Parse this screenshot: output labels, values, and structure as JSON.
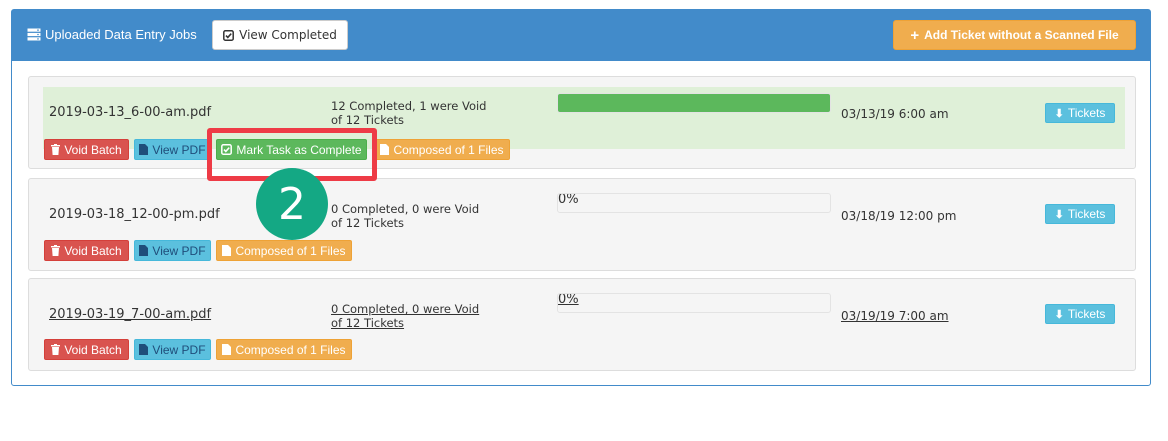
{
  "header": {
    "title": "Uploaded Data Entry Jobs",
    "view_completed_label": "View Completed",
    "add_ticket_label": "Add Ticket without a Scanned File"
  },
  "jobs": [
    {
      "filename": "2019-03-13_6-00-am.pdf",
      "status_line1": "12 Completed, 1 were Void",
      "status_line2": "of 12 Tickets",
      "progress_fraction": 1.0,
      "progress_label": "",
      "date": "03/13/19 6:00 am",
      "tickets_label": "Tickets",
      "void_label": "Void Batch",
      "view_pdf_label": "View PDF",
      "mark_complete_label": "Mark Task as Complete",
      "composed_label": "Composed of 1 Files"
    },
    {
      "filename": "2019-03-18_12-00-pm.pdf",
      "status_line1": "0 Completed, 0 were Void",
      "status_line2": "of 12 Tickets",
      "progress_fraction": 0,
      "progress_label": "0%",
      "date": "03/18/19 12:00 pm",
      "tickets_label": "Tickets",
      "void_label": "Void Batch",
      "view_pdf_label": "View PDF",
      "composed_label": "Composed of 1 Files"
    },
    {
      "filename": "2019-03-19_7-00-am.pdf",
      "status_line1": "0 Completed, 0 were Void",
      "status_line2": "of 12 Tickets",
      "progress_fraction": 0,
      "progress_label": "0%",
      "date": "03/19/19 7:00 am",
      "tickets_label": "Tickets",
      "void_label": "Void Batch",
      "view_pdf_label": "View PDF",
      "composed_label": "Composed of 1 Files"
    }
  ],
  "annotation": {
    "step_number": "2"
  },
  "colors": {
    "primary": "#428bca",
    "success": "#5cb85c",
    "warning": "#f0ad4e",
    "danger": "#d9534f",
    "info": "#5bc0de",
    "callout_red": "#ee3b46",
    "callout_teal": "#14a884"
  }
}
